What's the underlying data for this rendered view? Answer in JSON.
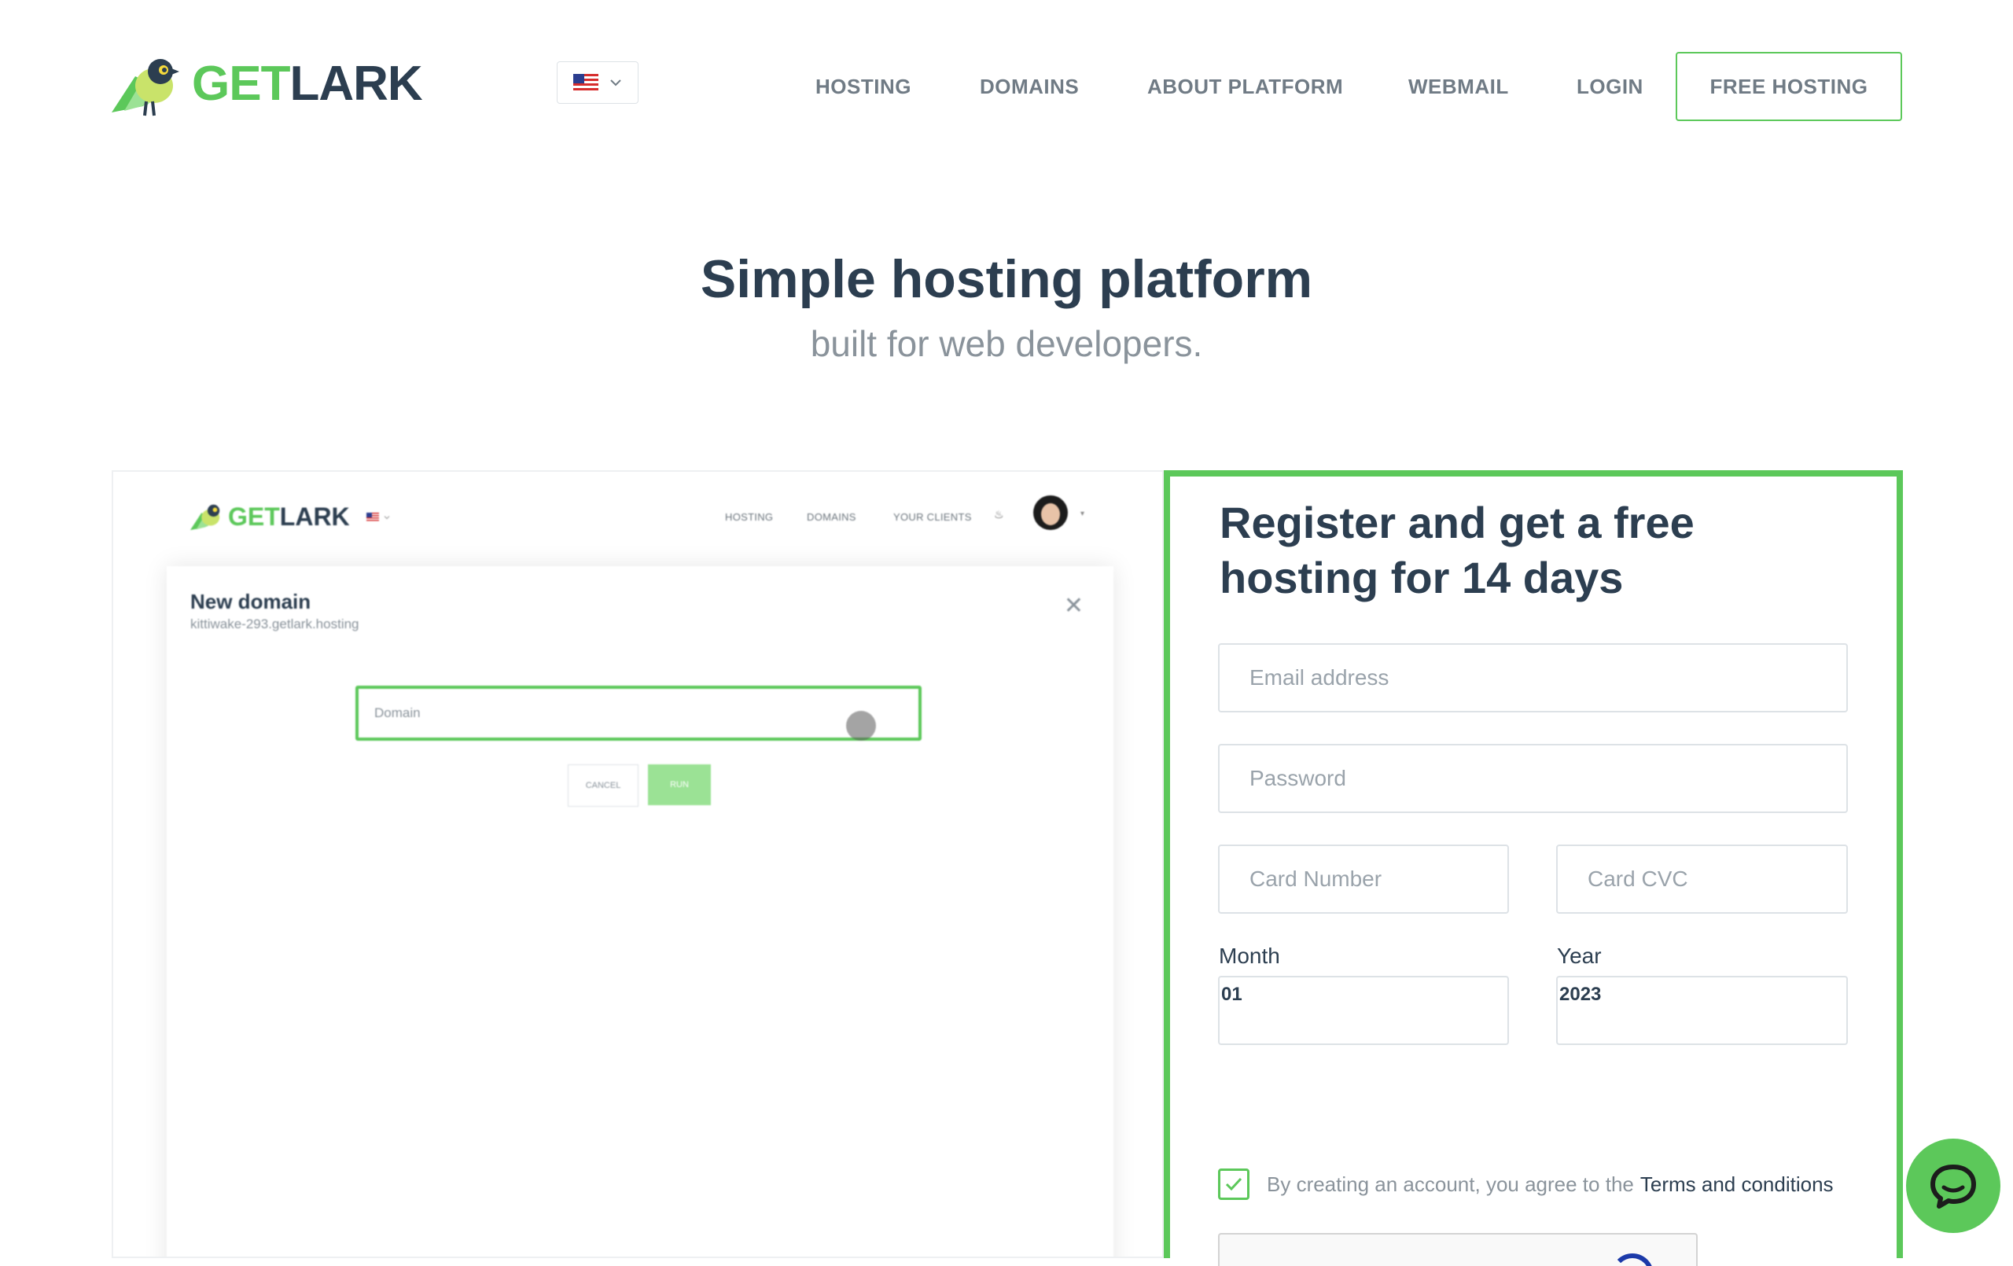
{
  "header": {
    "logo": {
      "get": "GET",
      "lark": "LARK"
    },
    "language": {
      "selected": "en-US",
      "flag": "us-flag-icon"
    },
    "nav": [
      {
        "label": "HOSTING"
      },
      {
        "label": "DOMAINS"
      },
      {
        "label": "ABOUT PLATFORM"
      },
      {
        "label": "WEBMAIL"
      },
      {
        "label": "LOGIN"
      }
    ],
    "cta_label": "FREE HOSTING"
  },
  "hero": {
    "title": "Simple hosting platform",
    "subtitle": "built for web developers."
  },
  "preview": {
    "logo": {
      "get": "GET",
      "lark": "LARK"
    },
    "nav": [
      {
        "label": "HOSTING"
      },
      {
        "label": "DOMAINS"
      },
      {
        "label": "YOUR CLIENTS"
      }
    ],
    "modal": {
      "title": "New domain",
      "subtitle": "kittiwake-293.getlark.hosting",
      "domain_placeholder": "Domain",
      "cancel_label": "CANCEL",
      "run_label": "RUN"
    }
  },
  "register": {
    "title": "Register and get a free hosting for 14 days",
    "email_placeholder": "Email address",
    "password_placeholder": "Password",
    "card_number_placeholder": "Card Number",
    "card_cvc_placeholder": "Card CVC",
    "month_label": "Month",
    "month_value": "01",
    "year_label": "Year",
    "year_value": "2023",
    "terms_text": "By creating an account, you agree to the",
    "terms_link": "Terms and conditions",
    "terms_checked": true
  },
  "chat": {
    "icon": "chat-bubble-icon"
  },
  "colors": {
    "accent": "#5cc85a",
    "dark": "#2c3e50",
    "muted": "#8a939b",
    "nav": "#707b85",
    "border": "#dde2e6"
  }
}
